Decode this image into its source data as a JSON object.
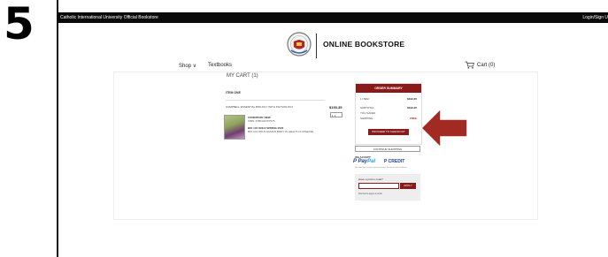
{
  "step": {
    "number": "5"
  },
  "topbar": {
    "left_text": "Catholic International University Official Bookstore",
    "right_text": "Login/Sign U"
  },
  "header": {
    "title": "ONLINE BOOKSTORE",
    "logo": "university-seal-logo"
  },
  "nav": {
    "shop": "Shop ∨",
    "textbooks": "Textbooks",
    "cart": "Cart (0)"
  },
  "cart": {
    "heading": "MY CART (1)",
    "item_heading": "ITEM ONE",
    "product_title": "CAMPBELL ESSENTIAL BIOLOGY WITH PHYSIOLOGY",
    "price": "$193.35",
    "qty": "1",
    "condition": "CONDITION: NEW",
    "isbn": "ISBN: 9780134767575",
    "course_1": "BIO 104 ONLN SPRING 2022",
    "course_2": "BIO 104 ONLN HUMAN BODY IN HEALTH & DISEASE"
  },
  "summary": {
    "title": "ORDER SUMMARY",
    "items_label": "1 ITEM",
    "items_value": "$193.35",
    "subtotal_label": "SUBTOTAL",
    "subtotal_value": "$193.35",
    "saved_label": "YOU SAVED",
    "saved_value": "",
    "shipping_label": "SHIPPING",
    "shipping_value": "FREE",
    "checkout": "PROCEED TO CHECKOUT",
    "continue": "CONTINUE SHOPPING"
  },
  "payment": {
    "accept": "WE ACCEPT",
    "paypal_1": "Pay",
    "paypal_2": "Pal",
    "credit": "P CREDIT",
    "fineprint": "Get more time to pay for your purchase. See terms and conditions."
  },
  "promo": {
    "label": "Have a promo code?",
    "apply": "APPLY",
    "note": "Discounts apply at order"
  },
  "colors": {
    "accent": "#8a1a1a",
    "arrow": "#a12a22"
  }
}
